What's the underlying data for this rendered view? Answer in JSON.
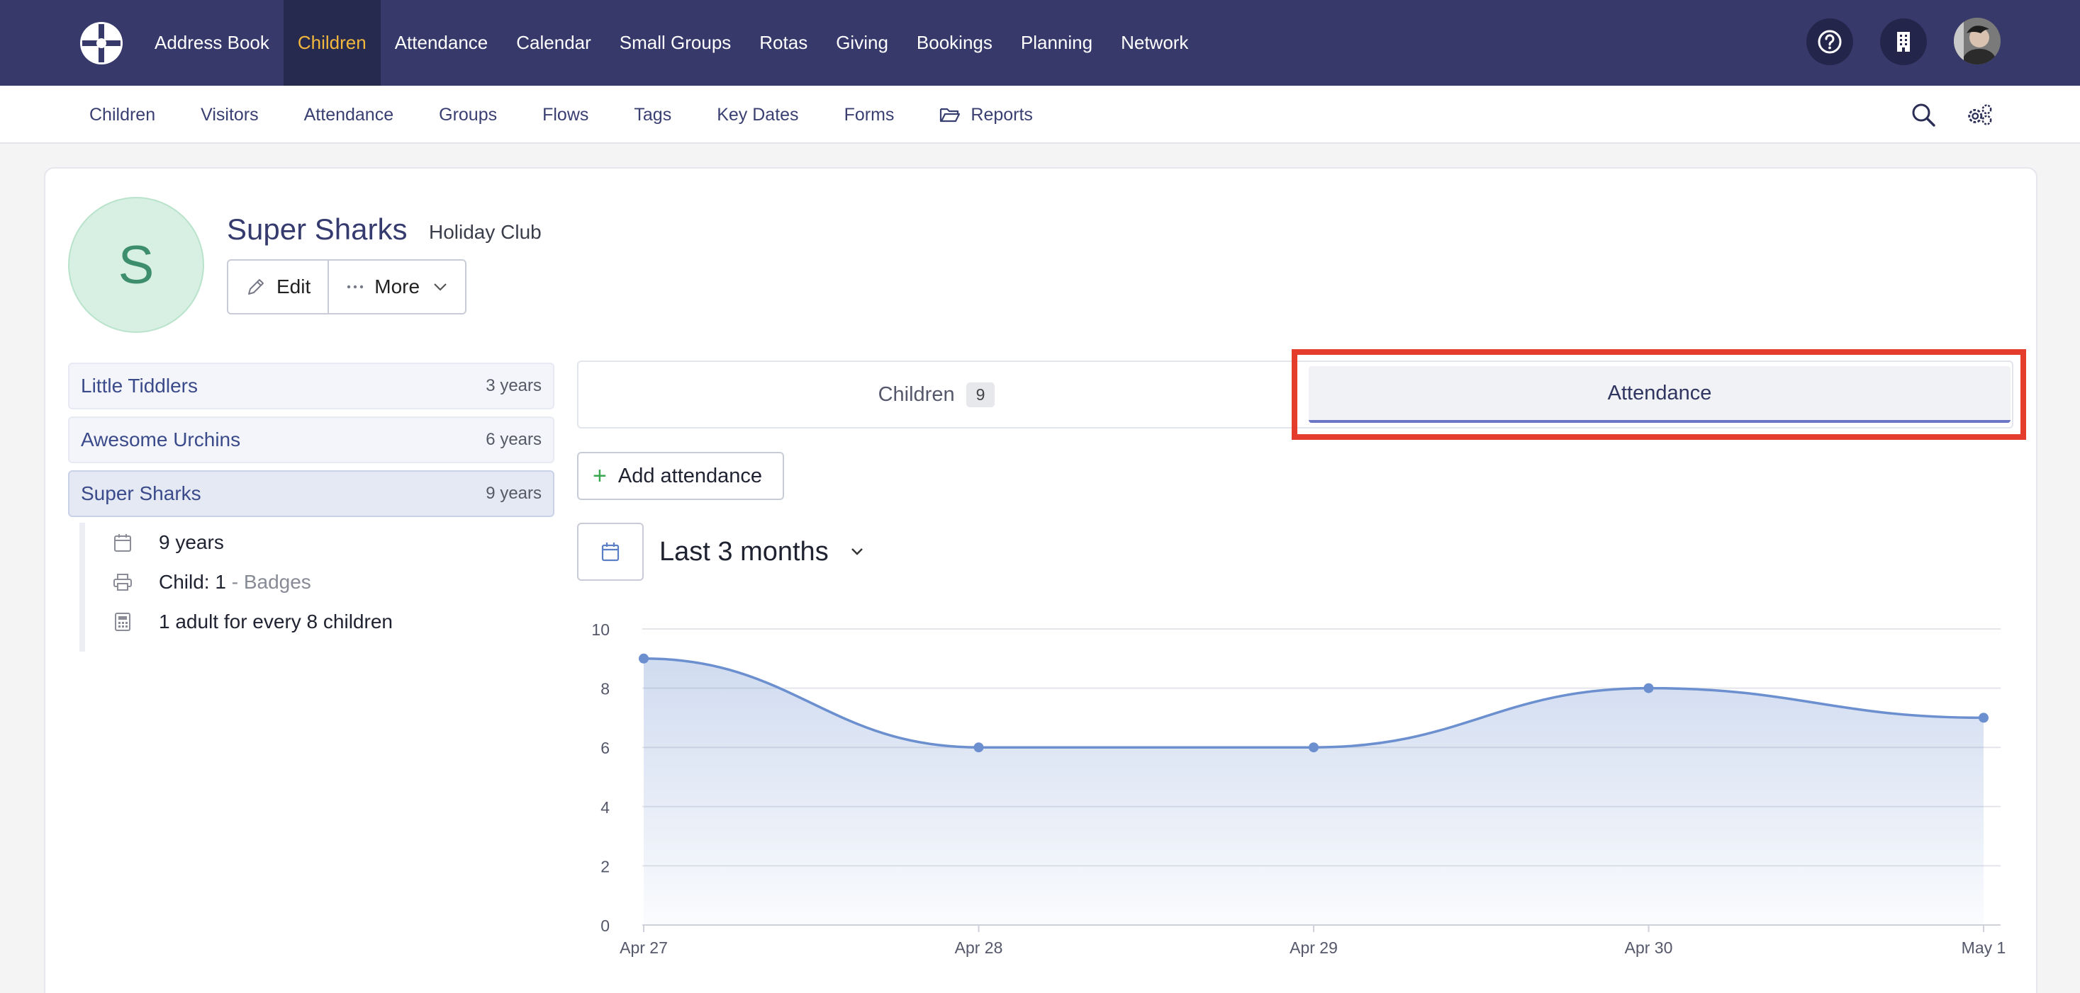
{
  "topnav": {
    "items": [
      "Address Book",
      "Children",
      "Attendance",
      "Calendar",
      "Small Groups",
      "Rotas",
      "Giving",
      "Bookings",
      "Planning",
      "Network"
    ],
    "active": "Children",
    "colors": {
      "bar": "#36396a",
      "active_bg": "#262a4f",
      "active_text": "#f4b73e"
    }
  },
  "subnav": {
    "items": [
      "Children",
      "Visitors",
      "Attendance",
      "Groups",
      "Flows",
      "Tags",
      "Key Dates",
      "Forms"
    ],
    "reports_label": "Reports",
    "icons": {
      "reports": "folder-open-icon",
      "search": "search-icon",
      "settings": "gears-icon"
    }
  },
  "header": {
    "avatar_letter": "S",
    "title": "Super Sharks",
    "subtitle": "Holiday Club",
    "edit_label": "Edit",
    "more_label": "More"
  },
  "groups": [
    {
      "name": "Little Tiddlers",
      "age": "3 years"
    },
    {
      "name": "Awesome Urchins",
      "age": "6 years"
    },
    {
      "name": "Super Sharks",
      "age": "9 years",
      "selected": true
    }
  ],
  "details": {
    "age": "9 years",
    "badges_prefix": "Child: 1",
    "badges_suffix": "- Badges",
    "ratio": "1 adult for every 8 children"
  },
  "tabs": {
    "children_label": "Children",
    "children_count": "9",
    "attendance_label": "Attendance",
    "active": "Attendance",
    "highlight_color": "#e43d2b"
  },
  "actions": {
    "add_attendance_label": "Add attendance",
    "range_label": "Last 3 months"
  },
  "chart_data": {
    "type": "area",
    "categories": [
      "Apr 27",
      "Apr 28",
      "Apr 29",
      "Apr 30",
      "May 1"
    ],
    "values": [
      9,
      6,
      6,
      8,
      7
    ],
    "ylim": [
      0,
      10
    ],
    "yticks": [
      0,
      2,
      4,
      6,
      8,
      10
    ],
    "grid": true,
    "title": "",
    "xlabel": "",
    "ylabel": "",
    "color": "#6b8fcf"
  }
}
